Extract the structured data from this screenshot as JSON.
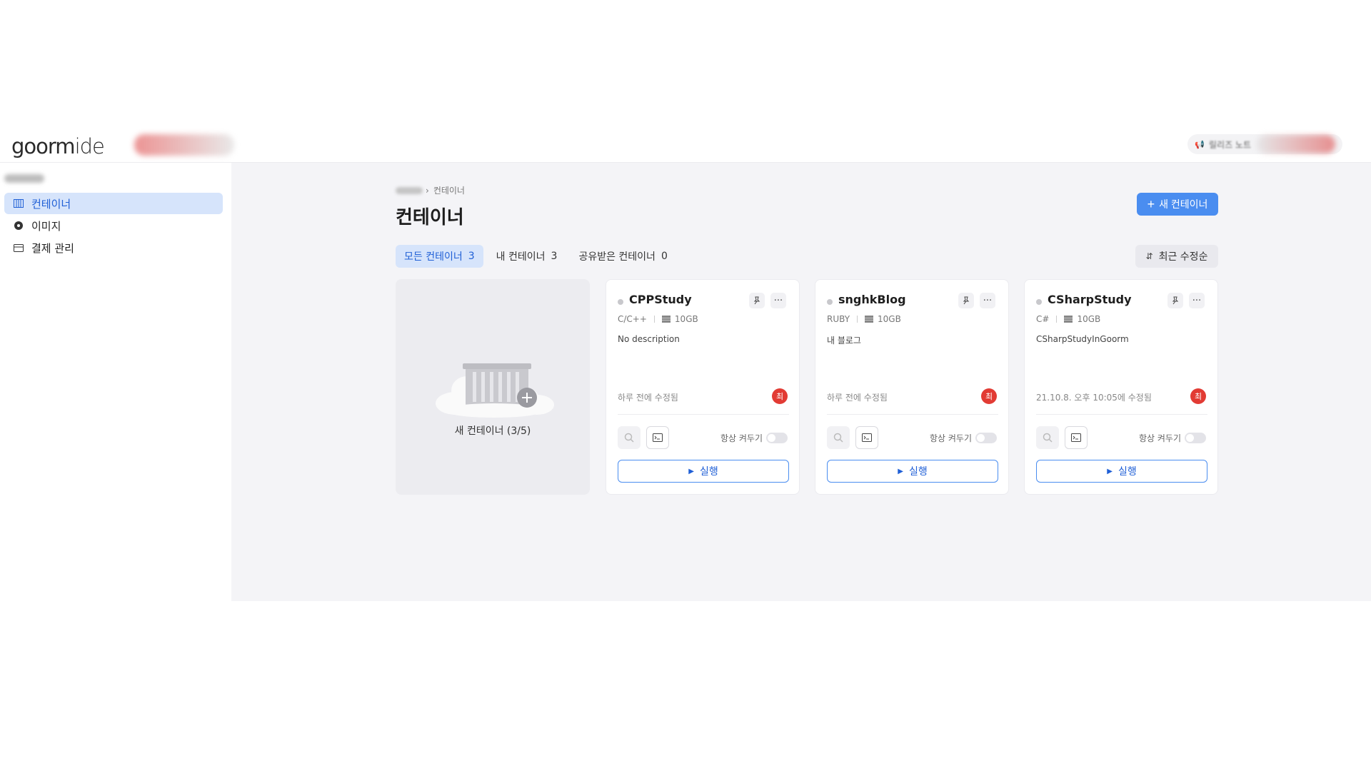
{
  "header": {
    "logo_main": "goorm",
    "logo_ide": "ide",
    "notice_label": "릴리즈 노트"
  },
  "sidebar": {
    "items": [
      {
        "label": "컨테이너",
        "icon": "container-icon",
        "active": true
      },
      {
        "label": "이미지",
        "icon": "image-icon",
        "active": false
      },
      {
        "label": "결제 관리",
        "icon": "card-icon",
        "active": false
      }
    ]
  },
  "main": {
    "breadcrumb_current": "컨테이너",
    "title": "컨테이너",
    "new_button_label": "새 컨테이너",
    "sort_label": "최근 수정순",
    "tabs": [
      {
        "label": "모든 컨테이너",
        "count": "3",
        "active": true
      },
      {
        "label": "내 컨테이너",
        "count": "3",
        "active": false
      },
      {
        "label": "공유받은 컨테이너",
        "count": "0",
        "active": false
      }
    ],
    "new_card_label": "새 컨테이너 (3/5)",
    "cards": [
      {
        "name": "CPPStudy",
        "stack": "C/C++",
        "storage": "10GB",
        "description": "No description",
        "modified": "하루 전에 수정됨",
        "owner_initial": "최",
        "always_on_label": "항상 켜두기",
        "run_label": "실행"
      },
      {
        "name": "snghkBlog",
        "stack": "RUBY",
        "storage": "10GB",
        "description": "내 블로그",
        "modified": "하루 전에 수정됨",
        "owner_initial": "최",
        "always_on_label": "항상 켜두기",
        "run_label": "실행"
      },
      {
        "name": "CSharpStudy",
        "stack": "C#",
        "storage": "10GB",
        "description": "CSharpStudyInGoorm",
        "modified": "21.10.8. 오후 10:05에 수정됨",
        "owner_initial": "최",
        "always_on_label": "항상 켜두기",
        "run_label": "실행"
      }
    ]
  },
  "colors": {
    "accent": "#4a8df0",
    "active_bg": "#d6e4fb",
    "avatar": "#e23b34",
    "main_bg": "#f4f4f7"
  }
}
